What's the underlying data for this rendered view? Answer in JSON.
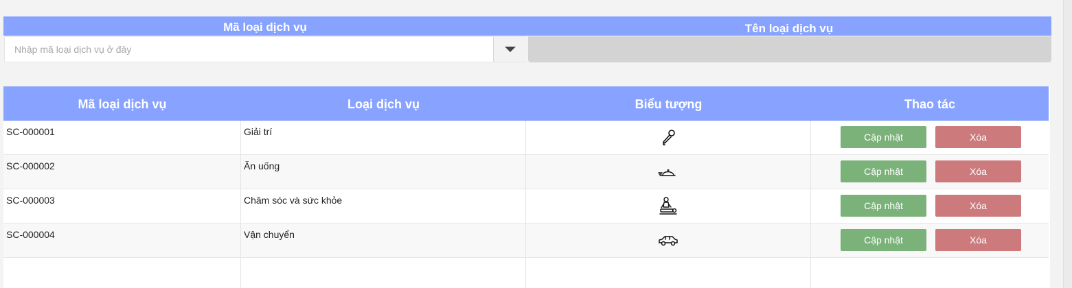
{
  "form": {
    "code_label": "Mã loại dịch vụ",
    "name_label": "Tên loại dịch vụ",
    "code_placeholder": "Nhập mã loại dịch vụ ở đây",
    "name_value": ""
  },
  "table": {
    "headers": [
      "Mã loại dịch vụ",
      "Loại dịch vụ",
      "Biểu tượng",
      "Thao tác"
    ],
    "rows": [
      {
        "code": "SC-000001",
        "name": "Giải trí",
        "icon": "microphone-icon"
      },
      {
        "code": "SC-000002",
        "name": "Ăn uống",
        "icon": "food-cloche-icon"
      },
      {
        "code": "SC-000003",
        "name": "Chăm sóc và sức khỏe",
        "icon": "massage-icon"
      },
      {
        "code": "SC-000004",
        "name": "Vận chuyển",
        "icon": "car-icon"
      }
    ],
    "update_label": "Cập nhật",
    "delete_label": "Xóa"
  },
  "colors": {
    "header_bg": "#87a3ff",
    "update_btn": "#7ab27a",
    "delete_btn": "#cc7a7c",
    "name_field_bg": "#d3d3d3"
  }
}
